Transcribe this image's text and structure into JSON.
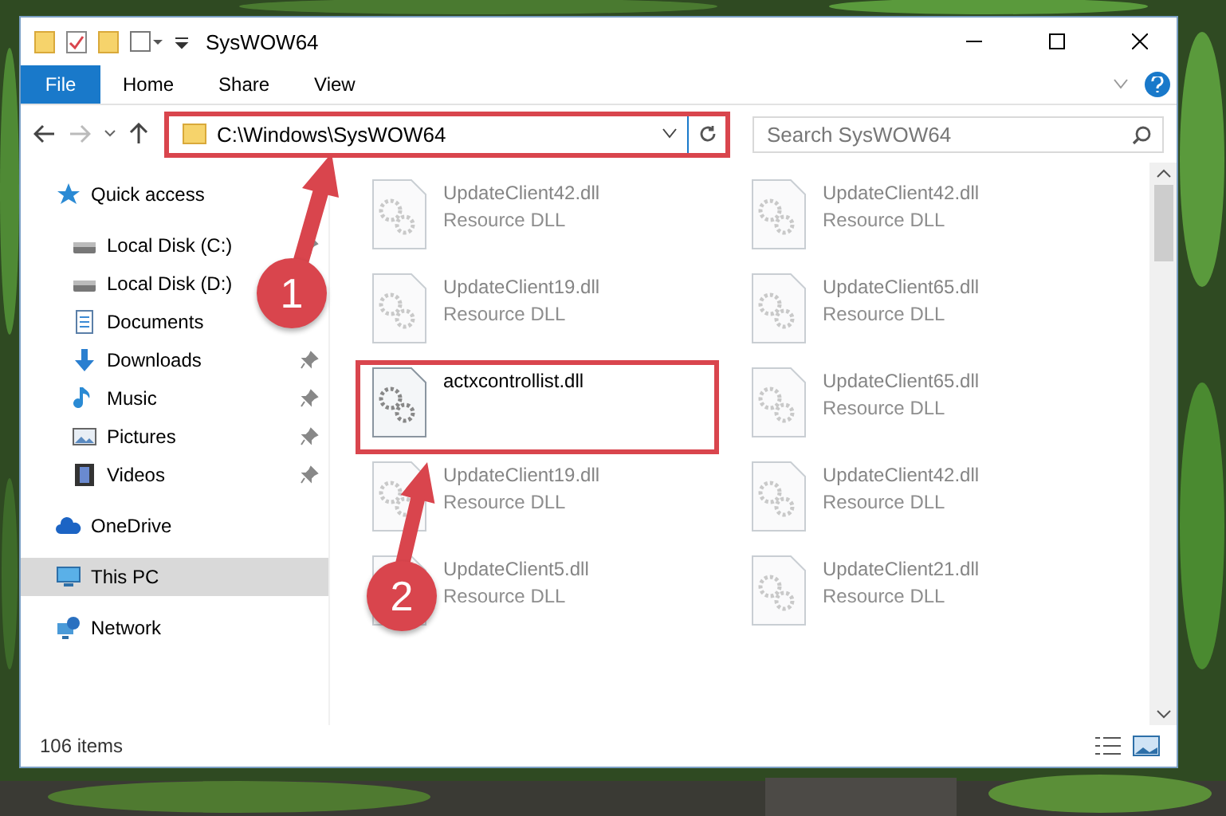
{
  "window": {
    "title": "SysWOW64"
  },
  "ribbon_tabs": [
    {
      "label": "File",
      "selected": true
    },
    {
      "label": "Home",
      "selected": false
    },
    {
      "label": "Share",
      "selected": false
    },
    {
      "label": "View",
      "selected": false
    }
  ],
  "address": {
    "path": "C:\\Windows\\SysWOW64",
    "highlighted": true
  },
  "search": {
    "placeholder": "Search SysWOW64"
  },
  "sidebar": {
    "items": [
      {
        "label": "Quick access",
        "kind": "star",
        "selected": false,
        "children": [
          {
            "label": "Local Disk (C:)",
            "kind": "drive",
            "pinned": true,
            "selected": false
          },
          {
            "label": "Local Disk (D:)",
            "kind": "drive",
            "pinned": false,
            "selected": false
          },
          {
            "label": "Documents",
            "kind": "documents",
            "pinned": false,
            "selected": false
          },
          {
            "label": "Downloads",
            "kind": "download",
            "pinned": true,
            "selected": false
          },
          {
            "label": "Music",
            "kind": "music",
            "pinned": true,
            "selected": false
          },
          {
            "label": "Pictures",
            "kind": "pictures",
            "pinned": true,
            "selected": false
          },
          {
            "label": "Videos",
            "kind": "videos",
            "pinned": true,
            "selected": false
          }
        ]
      },
      {
        "label": "OneDrive",
        "kind": "cloud",
        "selected": false
      },
      {
        "label": "This PC",
        "kind": "computer",
        "selected": true
      },
      {
        "label": "Network",
        "kind": "network",
        "selected": false
      }
    ]
  },
  "files": [
    {
      "name": "UpdateClient42.dll",
      "type": "Resource DLL",
      "faded": true,
      "highlighted": false
    },
    {
      "name": "UpdateClient42.dll",
      "type": "Resource DLL",
      "faded": true,
      "highlighted": false
    },
    {
      "name": "UpdateClient19.dll",
      "type": "Resource DLL",
      "faded": true,
      "highlighted": false
    },
    {
      "name": "UpdateClient65.dll",
      "type": "Resource DLL",
      "faded": true,
      "highlighted": false
    },
    {
      "name": "actxcontrollist.dll",
      "faded": false,
      "highlighted": true
    },
    {
      "name": "UpdateClient65.dll",
      "type": "Resource DLL",
      "faded": true,
      "highlighted": false
    },
    {
      "name": "UpdateClient19.dll",
      "type": "Resource DLL",
      "faded": true,
      "highlighted": false
    },
    {
      "name": "UpdateClient42.dll",
      "type": "Resource DLL",
      "faded": true,
      "highlighted": false
    },
    {
      "name": "UpdateClient5.dll",
      "type": "Resource DLL",
      "faded": true,
      "highlighted": false
    },
    {
      "name": "UpdateClient21.dll",
      "type": "Resource DLL",
      "faded": true,
      "highlighted": false
    }
  ],
  "status_bar": {
    "count": "106 items"
  },
  "annotations": [
    {
      "label": "1"
    },
    {
      "label": "2"
    }
  ]
}
